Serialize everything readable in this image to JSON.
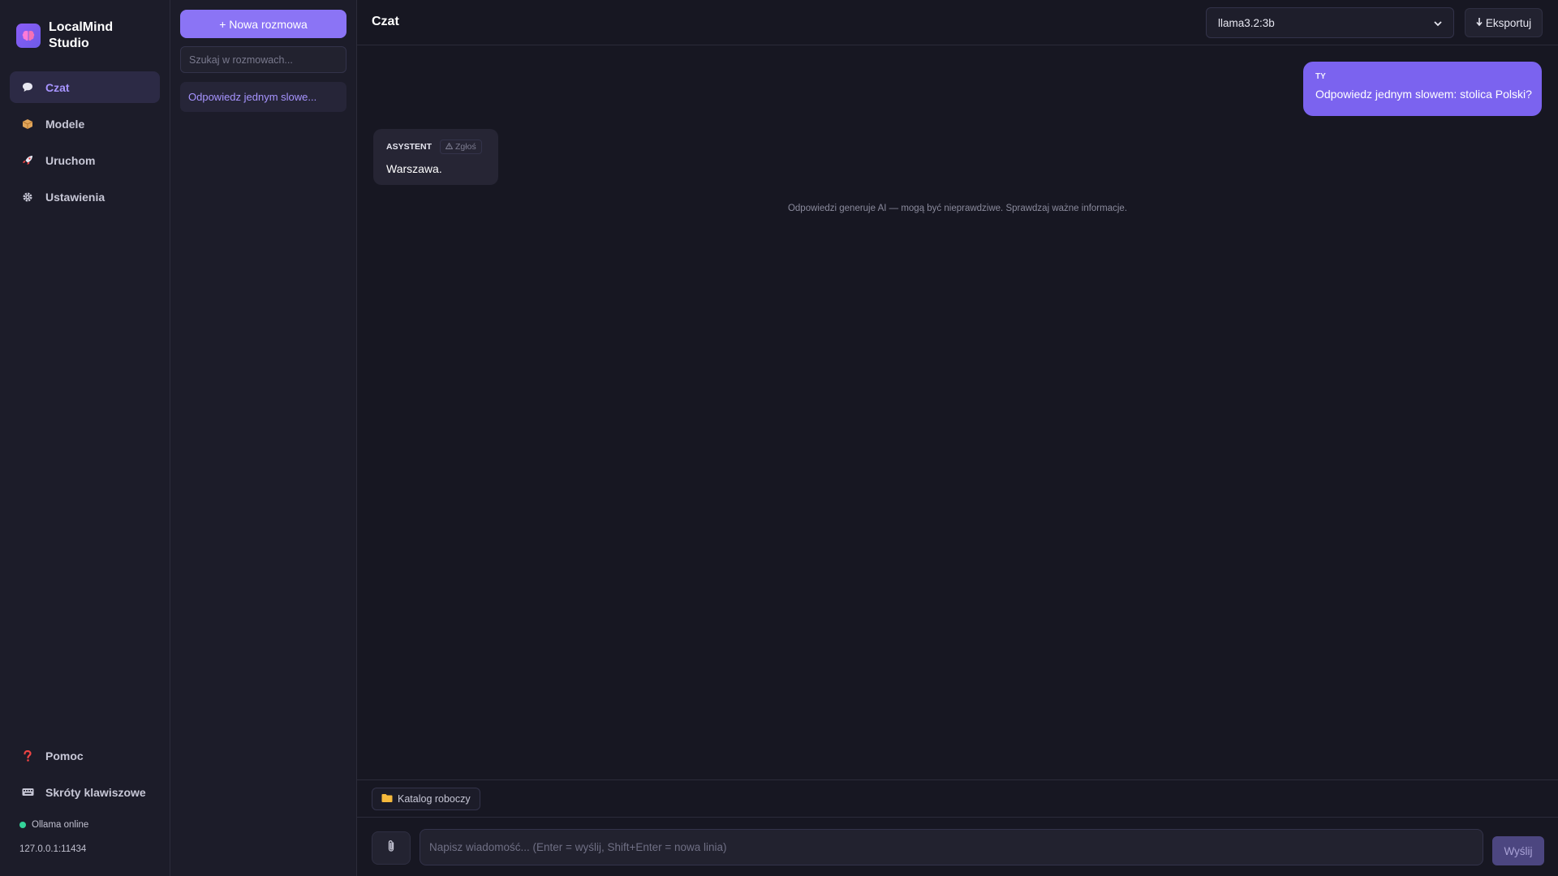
{
  "app": {
    "name": "LocalMind Studio",
    "logo_icon": "brain-icon"
  },
  "nav": {
    "items": [
      {
        "label": "Czat",
        "icon": "chat-bubble-icon",
        "active": true
      },
      {
        "label": "Modele",
        "icon": "package-icon",
        "active": false
      },
      {
        "label": "Uruchom",
        "icon": "rocket-icon",
        "active": false
      },
      {
        "label": "Ustawienia",
        "icon": "gear-icon",
        "active": false
      }
    ],
    "bottom_items": [
      {
        "label": "Pomoc",
        "icon": "question-icon"
      },
      {
        "label": "Skróty klawiszowe",
        "icon": "keyboard-icon"
      }
    ],
    "status": {
      "text": "Ollama online",
      "color": "#34d399"
    },
    "host": "127.0.0.1:11434"
  },
  "conversations": {
    "new_button": "+ Nowa rozmowa",
    "search_placeholder": "Szukaj w rozmowach...",
    "items": [
      {
        "title": "Odpowiedz jednym slowe...",
        "active": true
      }
    ]
  },
  "main": {
    "title": "Czat",
    "model_selected": "llama3.2:3b",
    "export_label": "Eksportuj",
    "messages": [
      {
        "role_label": "TY",
        "text": "Odpowiedz jednym slowem: stolica Polski?"
      },
      {
        "role_label": "ASYSTENT",
        "report_label": "Zgłoś",
        "text": "Warszawa."
      }
    ],
    "disclaimer": "Odpowiedzi generuje AI — mogą być nieprawdziwe. Sprawdzaj ważne informacje.",
    "folder_chip": "Katalog roboczy",
    "composer_placeholder": "Napisz wiadomość... (Enter = wyślij, Shift+Enter = nowa linia)",
    "send_label": "Wyślij"
  },
  "colors": {
    "accent": "#8b74f5",
    "user_bubble": "#7b63ef",
    "background": "#171722",
    "sidebar": "#1c1c29"
  }
}
